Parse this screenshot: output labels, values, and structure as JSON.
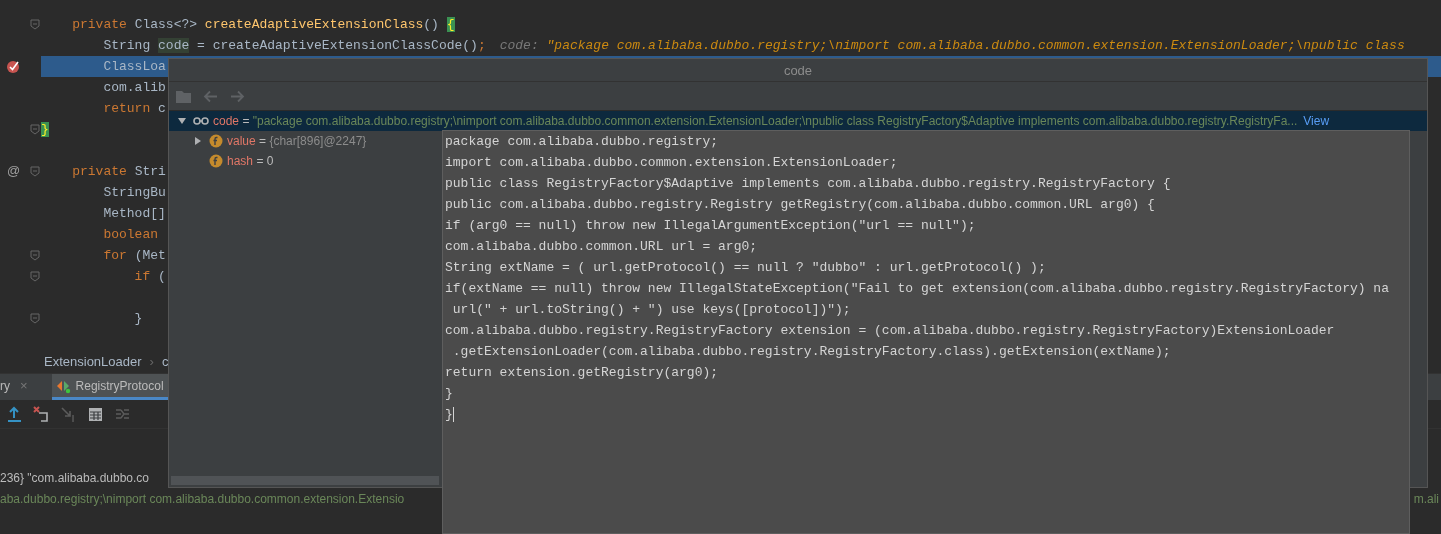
{
  "editor": {
    "lines": [
      {
        "tokens": [
          {
            "kind": "keyword",
            "text": "    private"
          },
          {
            "kind": "plain",
            "text": " Class<?> "
          },
          {
            "kind": "method",
            "text": "createAdaptiveExtensionClass"
          },
          {
            "kind": "plain",
            "text": "() "
          },
          {
            "kind": "brace",
            "text": "{"
          }
        ],
        "fold_marker": true,
        "current": false,
        "breakpoint": false
      },
      {
        "tokens": [
          {
            "kind": "plain",
            "text": "        String "
          },
          {
            "kind": "usage",
            "text": "code"
          },
          {
            "kind": "plain",
            "text": " = createAdaptiveExtensionClassCode()"
          },
          {
            "kind": "keyword",
            "text": ";"
          }
        ],
        "fold_marker": false,
        "current": false,
        "breakpoint": false,
        "hint": {
          "label": "code:",
          "value": "\"package com.alibaba.dubbo.registry;\\nimport com.alibaba.dubbo.common.extension.ExtensionLoader;\\npublic class"
        }
      },
      {
        "tokens": [
          {
            "kind": "plain",
            "text": "        ClassLoa"
          }
        ],
        "fold_marker": false,
        "current": true,
        "breakpoint": true
      },
      {
        "tokens": [
          {
            "kind": "plain",
            "text": "        com.alib"
          }
        ],
        "fold_marker": false,
        "current": false,
        "breakpoint": false
      },
      {
        "tokens": [
          {
            "kind": "keyword",
            "text": "        return"
          },
          {
            "kind": "plain",
            "text": " c"
          }
        ],
        "fold_marker": false,
        "current": false,
        "breakpoint": false
      },
      {
        "tokens": [
          {
            "kind": "brace",
            "text": "}"
          }
        ],
        "fold_marker": true,
        "current": false,
        "breakpoint": false
      },
      {
        "fold_marker": false,
        "current": false,
        "breakpoint": false
      },
      {
        "tokens": [
          {
            "kind": "keyword",
            "text": "    private"
          },
          {
            "kind": "plain",
            "text": " Stri"
          }
        ],
        "fold_marker": true,
        "current": false,
        "breakpoint": false,
        "gutter_text": "@"
      },
      {
        "tokens": [
          {
            "kind": "plain",
            "text": "        StringBu"
          }
        ],
        "fold_marker": false,
        "current": false,
        "breakpoint": false
      },
      {
        "tokens": [
          {
            "kind": "plain",
            "text": "        Method[]"
          }
        ],
        "fold_marker": false,
        "current": false,
        "breakpoint": false
      },
      {
        "tokens": [
          {
            "kind": "keyword",
            "text": "        boolean"
          }
        ],
        "fold_marker": false,
        "current": false,
        "breakpoint": false
      },
      {
        "tokens": [
          {
            "kind": "keyword",
            "text": "        for"
          },
          {
            "kind": "plain",
            "text": " (Met"
          }
        ],
        "fold_marker": true,
        "current": false,
        "breakpoint": false
      },
      {
        "tokens": [
          {
            "kind": "keyword",
            "text": "            if"
          },
          {
            "kind": "plain",
            "text": " ("
          }
        ],
        "fold_marker": true,
        "current": false,
        "breakpoint": false
      },
      {
        "fold_marker": false,
        "current": false,
        "breakpoint": false
      },
      {
        "tokens": [
          {
            "kind": "plain",
            "text": "            }"
          }
        ],
        "fold_marker": true,
        "current": false,
        "breakpoint": false
      }
    ]
  },
  "breadcrumbs": [
    {
      "kind": "crumb",
      "text": "ExtensionLoader"
    },
    {
      "kind": "separator",
      "text": "›"
    },
    {
      "kind": "crumb",
      "text": "c"
    }
  ],
  "debug_tabs": [
    {
      "label": "ry",
      "selected": false,
      "close": "×",
      "kind": "plain"
    },
    {
      "label": "RegistryProtocol",
      "selected": true,
      "kind": "run-config"
    }
  ],
  "debug_toolbar": [
    {
      "disabled": false
    },
    {
      "disabled": false
    },
    {
      "disabled": true
    },
    {
      "disabled": false
    },
    {
      "disabled": true
    }
  ],
  "variables": [
    {
      "kind": "plain",
      "text": "236} \"com.alibaba.dubbo.co"
    },
    {
      "kind": "string",
      "text": "aba.dubbo.registry;\\nimport com.alibaba.dubbo.common.extension.Extensio",
      "tail": "m.ali"
    }
  ],
  "popup": {
    "title": "code",
    "toolbar": [
      {
        "disabled": true
      },
      {
        "disabled": true
      },
      {
        "disabled": true
      }
    ],
    "tree": [
      {
        "kind": "watch",
        "name": "code",
        "operator": "=",
        "value": "\"package com.alibaba.dubbo.registry;\\nimport com.alibaba.dubbo.common.extension.ExtensionLoader;\\npublic class RegistryFactory$Adaptive implements com.alibaba.dubbo.registry.RegistryFa...",
        "link": "View",
        "expanded": true,
        "selected": true,
        "children": [
          {
            "kind": "field",
            "name": "value",
            "operator": "=",
            "value": "{char[896]@2247}",
            "expanded": false,
            "selected": false
          },
          {
            "kind": "field",
            "name": "hash",
            "operator": "=",
            "value": "0",
            "selected": false
          }
        ]
      }
    ],
    "text_lines": [
      "package com.alibaba.dubbo.registry;",
      "import com.alibaba.dubbo.common.extension.ExtensionLoader;",
      "public class RegistryFactory$Adaptive implements com.alibaba.dubbo.registry.RegistryFactory {",
      "public com.alibaba.dubbo.registry.Registry getRegistry(com.alibaba.dubbo.common.URL arg0) {",
      "if (arg0 == null) throw new IllegalArgumentException(\"url == null\");",
      "com.alibaba.dubbo.common.URL url = arg0;",
      "String extName = ( url.getProtocol() == null ? \"dubbo\" : url.getProtocol() );",
      "if(extName == null) throw new IllegalStateException(\"Fail to get extension(com.alibaba.dubbo.registry.RegistryFactory) na",
      " url(\" + url.toString() + \") use keys([protocol])\");",
      "com.alibaba.dubbo.registry.RegistryFactory extension = (com.alibaba.dubbo.registry.RegistryFactory)ExtensionLoader",
      " .getExtensionLoader(com.alibaba.dubbo.registry.RegistryFactory.class).getExtension(extName);",
      "return extension.getRegistry(arg0);",
      "}",
      "}"
    ]
  }
}
